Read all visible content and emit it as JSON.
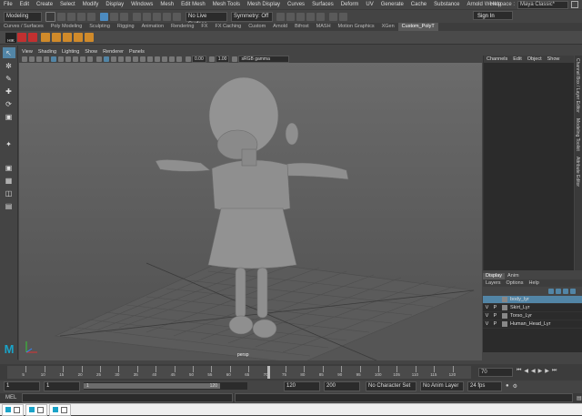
{
  "menubar": {
    "items": [
      "File",
      "Edit",
      "Create",
      "Select",
      "Modify",
      "Display",
      "Windows",
      "Mesh",
      "Edit Mesh",
      "Mesh Tools",
      "Mesh Display",
      "Curves",
      "Surfaces",
      "Deform",
      "UV",
      "Generate",
      "Cache",
      "Substance",
      "Arnold",
      "Help"
    ],
    "workspace_label": "Workspace :",
    "workspace_value": "Maya Classic*"
  },
  "statusline": {
    "mode": "Modeling",
    "live_surface": "No Live Surface",
    "symmetry": "Symmetry: Off",
    "sign_in": "Sign In"
  },
  "shelf": {
    "tabs": [
      "Curves / Surfaces",
      "Poly Modeling",
      "Sculpting",
      "Rigging",
      "Animation",
      "Rendering",
      "FX",
      "FX Caching",
      "Custom",
      "Arnold",
      "Bifrost",
      "MASH",
      "Motion Graphics",
      "XGen",
      "Custom_PolyT"
    ],
    "active_tab": 14,
    "first_icon_label": "HIK"
  },
  "viewport": {
    "menu": [
      "View",
      "Shading",
      "Lighting",
      "Show",
      "Renderer",
      "Panels"
    ],
    "field_a": "0.00",
    "field_b": "1.00",
    "colorspace": "sRGB gamma",
    "camera_label": "persp"
  },
  "channelbox": {
    "menu": [
      "Channels",
      "Edit",
      "Object",
      "Show"
    ],
    "side_tabs": [
      "Channel Box / Layer Editor",
      "Modeling Toolkit",
      "Attribute Editor"
    ]
  },
  "layers": {
    "tabs": [
      "Display",
      "Anim"
    ],
    "menu": [
      "Layers",
      "Options",
      "Help"
    ],
    "rows": [
      {
        "v": "",
        "p": "",
        "name": "body_lyr",
        "selected": true
      },
      {
        "v": "V",
        "p": "P",
        "name": "Skirt_Lyr",
        "selected": false
      },
      {
        "v": "V",
        "p": "P",
        "name": "Torso_Lyr",
        "selected": false
      },
      {
        "v": "V",
        "p": "P",
        "name": "Human_Head_Lyr",
        "selected": false
      }
    ]
  },
  "timeslider": {
    "ticks": [
      "5",
      "10",
      "15",
      "20",
      "25",
      "30",
      "35",
      "40",
      "45",
      "50",
      "55",
      "60",
      "65",
      "70",
      "75",
      "80",
      "85",
      "90",
      "95",
      "100",
      "105",
      "110",
      "115",
      "120"
    ],
    "current_frame": "70"
  },
  "range": {
    "start": "1",
    "playback_start": "1",
    "range_start_field": "1",
    "range_end_field": "120",
    "playback_end": "120",
    "end": "200",
    "character_set": "No Character Set",
    "anim_layer": "No Anim Layer",
    "fps": "24 fps"
  },
  "cmdline": {
    "label": "MEL"
  },
  "colors": {
    "accent": "#5285a6",
    "bg": "#444444",
    "viewport_top": "#6b6b6b"
  }
}
